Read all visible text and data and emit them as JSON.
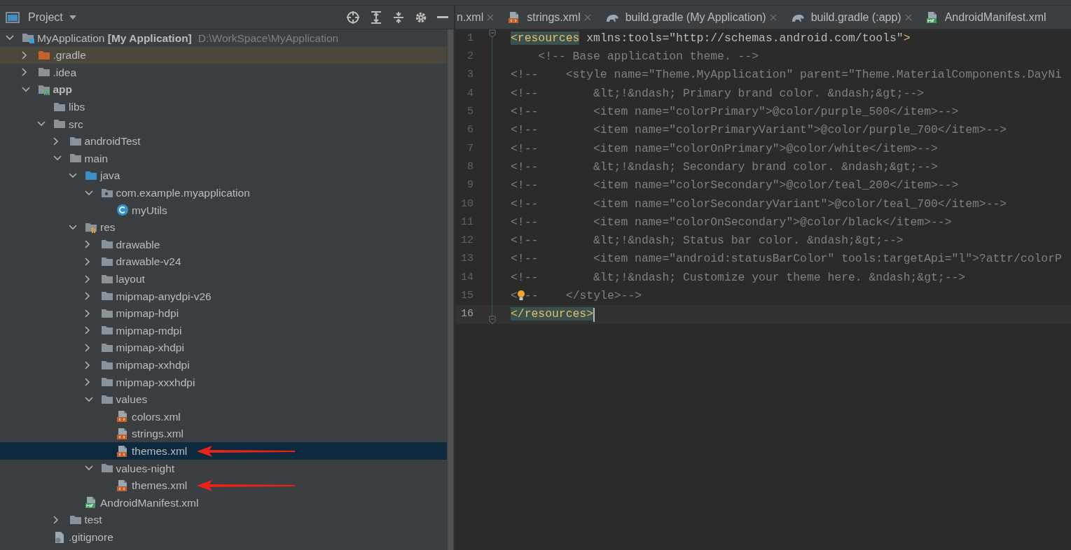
{
  "project_panel": {
    "title": "Project"
  },
  "tree": [
    {
      "kind": "project",
      "label": "MyApplication **[My Application]**",
      "path": "D:\\WorkSpace\\MyApplication",
      "expanded": true,
      "selected": false,
      "highlighted": false,
      "arrow": false,
      "children": [
        {
          "kind": "excluded-folder",
          "label": ".gradle",
          "expanded": false,
          "selected": false,
          "highlighted": true,
          "arrow": false
        },
        {
          "kind": "folder",
          "label": ".idea",
          "expanded": false,
          "selected": false,
          "highlighted": false,
          "arrow": false
        },
        {
          "kind": "module",
          "label": "app",
          "expanded": true,
          "selected": false,
          "highlighted": false,
          "arrow": false,
          "children": [
            {
              "kind": "folder",
              "label": "libs",
              "selected": false,
              "highlighted": false,
              "arrow": false
            },
            {
              "kind": "folder",
              "label": "src",
              "expanded": true,
              "selected": false,
              "highlighted": false,
              "arrow": false,
              "children": [
                {
                  "kind": "folder",
                  "label": "androidTest",
                  "expanded": false,
                  "selected": false,
                  "highlighted": false,
                  "arrow": false
                },
                {
                  "kind": "folder",
                  "label": "main",
                  "expanded": true,
                  "selected": false,
                  "highlighted": false,
                  "arrow": false,
                  "children": [
                    {
                      "kind": "source-folder",
                      "label": "java",
                      "expanded": true,
                      "selected": false,
                      "highlighted": false,
                      "arrow": false,
                      "children": [
                        {
                          "kind": "package",
                          "label": "com.example.myapplication",
                          "expanded": true,
                          "selected": false,
                          "highlighted": false,
                          "arrow": false,
                          "children": [
                            {
                              "kind": "class",
                              "label": "myUtils",
                              "selected": false,
                              "highlighted": false,
                              "arrow": false
                            }
                          ]
                        }
                      ]
                    },
                    {
                      "kind": "resource-folder",
                      "label": "res",
                      "expanded": true,
                      "selected": false,
                      "highlighted": false,
                      "arrow": false,
                      "children": [
                        {
                          "kind": "folder",
                          "label": "drawable",
                          "expanded": false,
                          "selected": false,
                          "highlighted": false,
                          "arrow": false
                        },
                        {
                          "kind": "folder",
                          "label": "drawable-v24",
                          "expanded": false,
                          "selected": false,
                          "highlighted": false,
                          "arrow": false
                        },
                        {
                          "kind": "folder",
                          "label": "layout",
                          "expanded": false,
                          "selected": false,
                          "highlighted": false,
                          "arrow": false
                        },
                        {
                          "kind": "folder",
                          "label": "mipmap-anydpi-v26",
                          "expanded": false,
                          "selected": false,
                          "highlighted": false,
                          "arrow": false
                        },
                        {
                          "kind": "folder",
                          "label": "mipmap-hdpi",
                          "expanded": false,
                          "selected": false,
                          "highlighted": false,
                          "arrow": false
                        },
                        {
                          "kind": "folder",
                          "label": "mipmap-mdpi",
                          "expanded": false,
                          "selected": false,
                          "highlighted": false,
                          "arrow": false
                        },
                        {
                          "kind": "folder",
                          "label": "mipmap-xhdpi",
                          "expanded": false,
                          "selected": false,
                          "highlighted": false,
                          "arrow": false
                        },
                        {
                          "kind": "folder",
                          "label": "mipmap-xxhdpi",
                          "expanded": false,
                          "selected": false,
                          "highlighted": false,
                          "arrow": false
                        },
                        {
                          "kind": "folder",
                          "label": "mipmap-xxxhdpi",
                          "expanded": false,
                          "selected": false,
                          "highlighted": false,
                          "arrow": false
                        },
                        {
                          "kind": "folder",
                          "label": "values",
                          "expanded": true,
                          "selected": false,
                          "highlighted": false,
                          "arrow": false,
                          "children": [
                            {
                              "kind": "xml",
                              "label": "colors.xml",
                              "selected": false,
                              "highlighted": false,
                              "arrow": false
                            },
                            {
                              "kind": "xml",
                              "label": "strings.xml",
                              "selected": false,
                              "highlighted": false,
                              "arrow": false
                            },
                            {
                              "kind": "xml",
                              "label": "themes.xml",
                              "selected": true,
                              "highlighted": false,
                              "arrow": true
                            }
                          ]
                        },
                        {
                          "kind": "folder",
                          "label": "values-night",
                          "expanded": true,
                          "selected": false,
                          "highlighted": false,
                          "arrow": false,
                          "children": [
                            {
                              "kind": "xml",
                              "label": "themes.xml",
                              "selected": false,
                              "highlighted": false,
                              "arrow": true
                            }
                          ]
                        }
                      ]
                    },
                    {
                      "kind": "manifest",
                      "label": "AndroidManifest.xml",
                      "selected": false,
                      "highlighted": false,
                      "arrow": false
                    }
                  ]
                },
                {
                  "kind": "folder",
                  "label": "test",
                  "expanded": false,
                  "selected": false,
                  "highlighted": false,
                  "arrow": false
                }
              ]
            },
            {
              "kind": "ignore-file",
              "label": ".gitignore",
              "selected": false,
              "highlighted": false,
              "arrow": false
            }
          ]
        }
      ]
    }
  ],
  "editor_tabs": [
    {
      "kind": "none",
      "label": "n.xml",
      "closable": true
    },
    {
      "kind": "xml",
      "label": "strings.xml",
      "closable": true
    },
    {
      "kind": "gradle",
      "label": "build.gradle (My Application)",
      "closable": true
    },
    {
      "kind": "gradle",
      "label": "build.gradle (:app)",
      "closable": true
    },
    {
      "kind": "manifest",
      "label": "AndroidManifest.xml",
      "closable": false
    }
  ],
  "code_lines": [
    {
      "number": "1",
      "current": false,
      "fold": true,
      "segments": [
        {
          "kind": "matched-tag",
          "text": "<resources"
        },
        {
          "kind": "attr",
          "text": " xmlns:tools=\"http://schemas.android.com/tools\""
        },
        {
          "kind": "tag",
          "text": ">"
        }
      ]
    },
    {
      "number": "2",
      "current": false,
      "fold": false,
      "segments": [
        {
          "kind": "comment",
          "text": "    <!-- Base application theme. -->"
        }
      ]
    },
    {
      "number": "3",
      "current": false,
      "fold": false,
      "segments": [
        {
          "kind": "comment",
          "text": "<!--    <style name=\"Theme.MyApplication\" parent=\"Theme.MaterialComponents.DayNi"
        }
      ]
    },
    {
      "number": "4",
      "current": false,
      "fold": false,
      "segments": [
        {
          "kind": "comment",
          "text": "<!--        &lt;!&ndash; Primary brand color. &ndash;&gt;-->"
        }
      ]
    },
    {
      "number": "5",
      "current": false,
      "fold": false,
      "segments": [
        {
          "kind": "comment",
          "text": "<!--        <item name=\"colorPrimary\">@color/purple_500</item>-->"
        }
      ]
    },
    {
      "number": "6",
      "current": false,
      "fold": false,
      "segments": [
        {
          "kind": "comment",
          "text": "<!--        <item name=\"colorPrimaryVariant\">@color/purple_700</item>-->"
        }
      ]
    },
    {
      "number": "7",
      "current": false,
      "fold": false,
      "segments": [
        {
          "kind": "comment",
          "text": "<!--        <item name=\"colorOnPrimary\">@color/white</item>-->"
        }
      ]
    },
    {
      "number": "8",
      "current": false,
      "fold": false,
      "segments": [
        {
          "kind": "comment",
          "text": "<!--        &lt;!&ndash; Secondary brand color. &ndash;&gt;-->"
        }
      ]
    },
    {
      "number": "9",
      "current": false,
      "fold": false,
      "segments": [
        {
          "kind": "comment",
          "text": "<!--        <item name=\"colorSecondary\">@color/teal_200</item>-->"
        }
      ]
    },
    {
      "number": "10",
      "current": false,
      "fold": false,
      "segments": [
        {
          "kind": "comment",
          "text": "<!--        <item name=\"colorSecondaryVariant\">@color/teal_700</item>-->"
        }
      ]
    },
    {
      "number": "11",
      "current": false,
      "fold": false,
      "segments": [
        {
          "kind": "comment",
          "text": "<!--        <item name=\"colorOnSecondary\">@color/black</item>-->"
        }
      ]
    },
    {
      "number": "12",
      "current": false,
      "fold": false,
      "segments": [
        {
          "kind": "comment",
          "text": "<!--        &lt;!&ndash; Status bar color. &ndash;&gt;-->"
        }
      ]
    },
    {
      "number": "13",
      "current": false,
      "fold": false,
      "segments": [
        {
          "kind": "comment",
          "text": "<!--        <item name=\"android:statusBarColor\" tools:targetApi=\"l\">?attr/colorP"
        }
      ]
    },
    {
      "number": "14",
      "current": false,
      "fold": false,
      "segments": [
        {
          "kind": "comment",
          "text": "<!--        &lt;!&ndash; Customize your theme here. &ndash;&gt;-->"
        }
      ]
    },
    {
      "number": "15",
      "current": false,
      "fold": false,
      "segments": [
        {
          "kind": "comment",
          "text": "<"
        },
        {
          "kind": "bulb"
        },
        {
          "kind": "comment",
          "text": "--    </style>-->"
        }
      ]
    },
    {
      "number": "16",
      "current": true,
      "fold": true,
      "segments": [
        {
          "kind": "matched-tag",
          "text": "</resources>"
        }
      ]
    }
  ]
}
